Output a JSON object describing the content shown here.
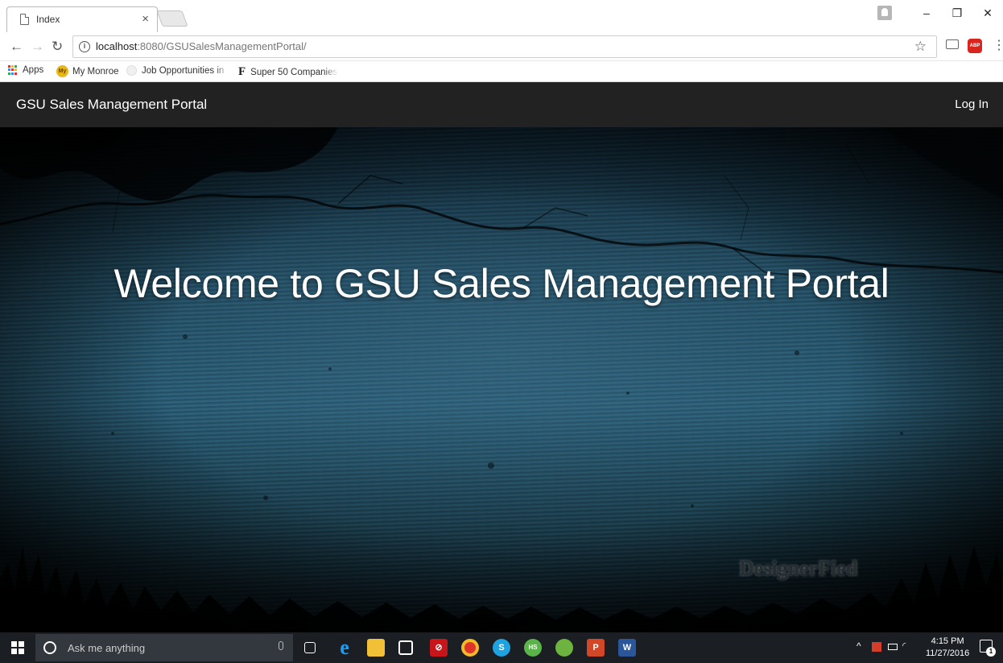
{
  "browser": {
    "tab_title": "Index",
    "tab_close": "×",
    "url_host": "localhost",
    "url_rest": ":8080/GSUSalesManagementPortal/",
    "window_buttons": [
      "–",
      "❐",
      "✕"
    ],
    "bookmarks": [
      {
        "label": "Apps",
        "icon": "apps-grid-icon"
      },
      {
        "label": "My Monroe",
        "icon": "my-monroe-icon",
        "icon_text": "My"
      },
      {
        "label": "Job Opportunities in",
        "icon": "job-icon"
      },
      {
        "label": "Super 50 Companies",
        "icon": "f-icon",
        "icon_text": "F"
      }
    ],
    "extension_abp": "ABP"
  },
  "page": {
    "brand": "GSU Sales Management Portal",
    "login": "Log In",
    "hero_title": "Welcome to GSU Sales Management Portal",
    "watermark": "DesignerFied"
  },
  "taskbar": {
    "search_placeholder": "Ask me anything",
    "time": "4:15 PM",
    "date": "11/27/2016",
    "notification_count": "1",
    "apps": [
      {
        "name": "task-view",
        "color": "#1b1f24"
      },
      {
        "name": "edge",
        "color": "#1f7ad6"
      },
      {
        "name": "file-explorer",
        "color": "#f2c037"
      },
      {
        "name": "store",
        "color": "#2a2f36"
      },
      {
        "name": "app-red",
        "color": "#c8151a"
      },
      {
        "name": "chrome",
        "color": "#e2332b"
      },
      {
        "name": "skype",
        "color": "#1ea3e0"
      },
      {
        "name": "hotspot-shield",
        "color": "#5bb44a"
      },
      {
        "name": "spring-tool",
        "color": "#6db33f"
      },
      {
        "name": "powerpoint",
        "color": "#d24726"
      },
      {
        "name": "word",
        "color": "#2b579a"
      }
    ]
  },
  "colors": {
    "navbar": "#222222",
    "taskbar": "#1b1f24",
    "hero_blue": "#2b607a"
  }
}
